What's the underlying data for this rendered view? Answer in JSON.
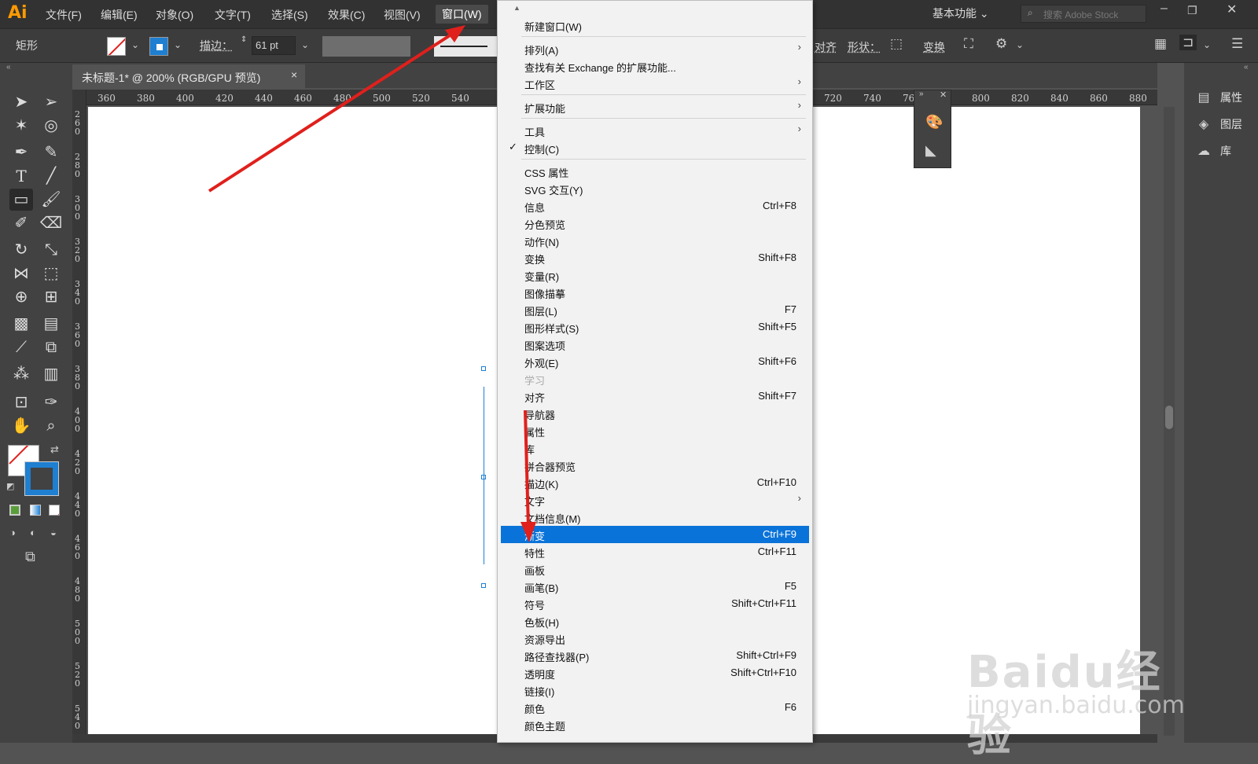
{
  "app": {
    "logo": "Ai",
    "menus": [
      "文件(F)",
      "编辑(E)",
      "对象(O)",
      "文字(T)",
      "选择(S)",
      "效果(C)",
      "视图(V)",
      "窗口(W)"
    ],
    "workspace": "基本功能",
    "stock_placeholder": "搜索 Adobe Stock"
  },
  "control_bar": {
    "shape_label": "矩形",
    "stroke_label": "描边：",
    "stroke_value": "61 pt",
    "align_label": "对齐",
    "shape_prop_label": "形状：",
    "transform_label": "变换"
  },
  "document_tab": {
    "title": "未标题-1* @ 200% (RGB/GPU 预览)",
    "close": "×"
  },
  "ruler_ticks": [
    "360",
    "380",
    "400",
    "420",
    "440",
    "460",
    "480",
    "500",
    "520",
    "540",
    "720",
    "740",
    "760",
    "800",
    "820",
    "840",
    "860",
    "880"
  ],
  "vruler_ticks": [
    "260",
    "280",
    "300",
    "320",
    "340",
    "360",
    "380",
    "400",
    "420",
    "440",
    "460",
    "480",
    "500",
    "520",
    "540"
  ],
  "right_panel": {
    "items": [
      "属性",
      "图层",
      "库"
    ]
  },
  "window_menu": {
    "items": [
      {
        "label": "新建窗口(W)"
      },
      {
        "label": "排列(A)",
        "submenu": "›"
      },
      {
        "label": "查找有关 Exchange 的扩展功能..."
      },
      {
        "label": "工作区",
        "submenu": "›"
      },
      {
        "label": "扩展功能",
        "submenu": "›"
      },
      {
        "label": "工具",
        "submenu": "›"
      },
      {
        "label": "控制(C)",
        "check": "✓"
      },
      {
        "label": "CSS 属性"
      },
      {
        "label": "SVG 交互(Y)"
      },
      {
        "label": "信息",
        "shortcut": "Ctrl+F8"
      },
      {
        "label": "分色预览"
      },
      {
        "label": "动作(N)"
      },
      {
        "label": "变换",
        "shortcut": "Shift+F8"
      },
      {
        "label": "变量(R)"
      },
      {
        "label": "图像描摹"
      },
      {
        "label": "图层(L)",
        "shortcut": "F7"
      },
      {
        "label": "图形样式(S)",
        "shortcut": "Shift+F5"
      },
      {
        "label": "图案选项"
      },
      {
        "label": "外观(E)",
        "shortcut": "Shift+F6"
      },
      {
        "label": "学习",
        "disabled": true
      },
      {
        "label": "对齐",
        "shortcut": "Shift+F7"
      },
      {
        "label": "导航器"
      },
      {
        "label": "属性"
      },
      {
        "label": "库"
      },
      {
        "label": "拼合器预览"
      },
      {
        "label": "描边(K)",
        "shortcut": "Ctrl+F10"
      },
      {
        "label": "文字",
        "submenu": "›"
      },
      {
        "label": "文档信息(M)"
      },
      {
        "label": "渐变",
        "shortcut": "Ctrl+F9",
        "highlighted": true
      },
      {
        "label": "特性",
        "shortcut": "Ctrl+F11"
      },
      {
        "label": "画板"
      },
      {
        "label": "画笔(B)",
        "shortcut": "F5"
      },
      {
        "label": "符号",
        "shortcut": "Shift+Ctrl+F11"
      },
      {
        "label": "色板(H)"
      },
      {
        "label": "资源导出"
      },
      {
        "label": "路径查找器(P)",
        "shortcut": "Shift+Ctrl+F9"
      },
      {
        "label": "透明度",
        "shortcut": "Shift+Ctrl+F10"
      },
      {
        "label": "链接(I)"
      },
      {
        "label": "颜色",
        "shortcut": "F6"
      },
      {
        "label": "颜色主题"
      }
    ]
  },
  "watermark": {
    "brand": "Baidu经验",
    "url": "jingyan.baidu.com"
  },
  "colors": {
    "menu_highlight": "#0a73d9",
    "annotation_arrow": "#e0201c",
    "logo": "#ff9a00"
  }
}
